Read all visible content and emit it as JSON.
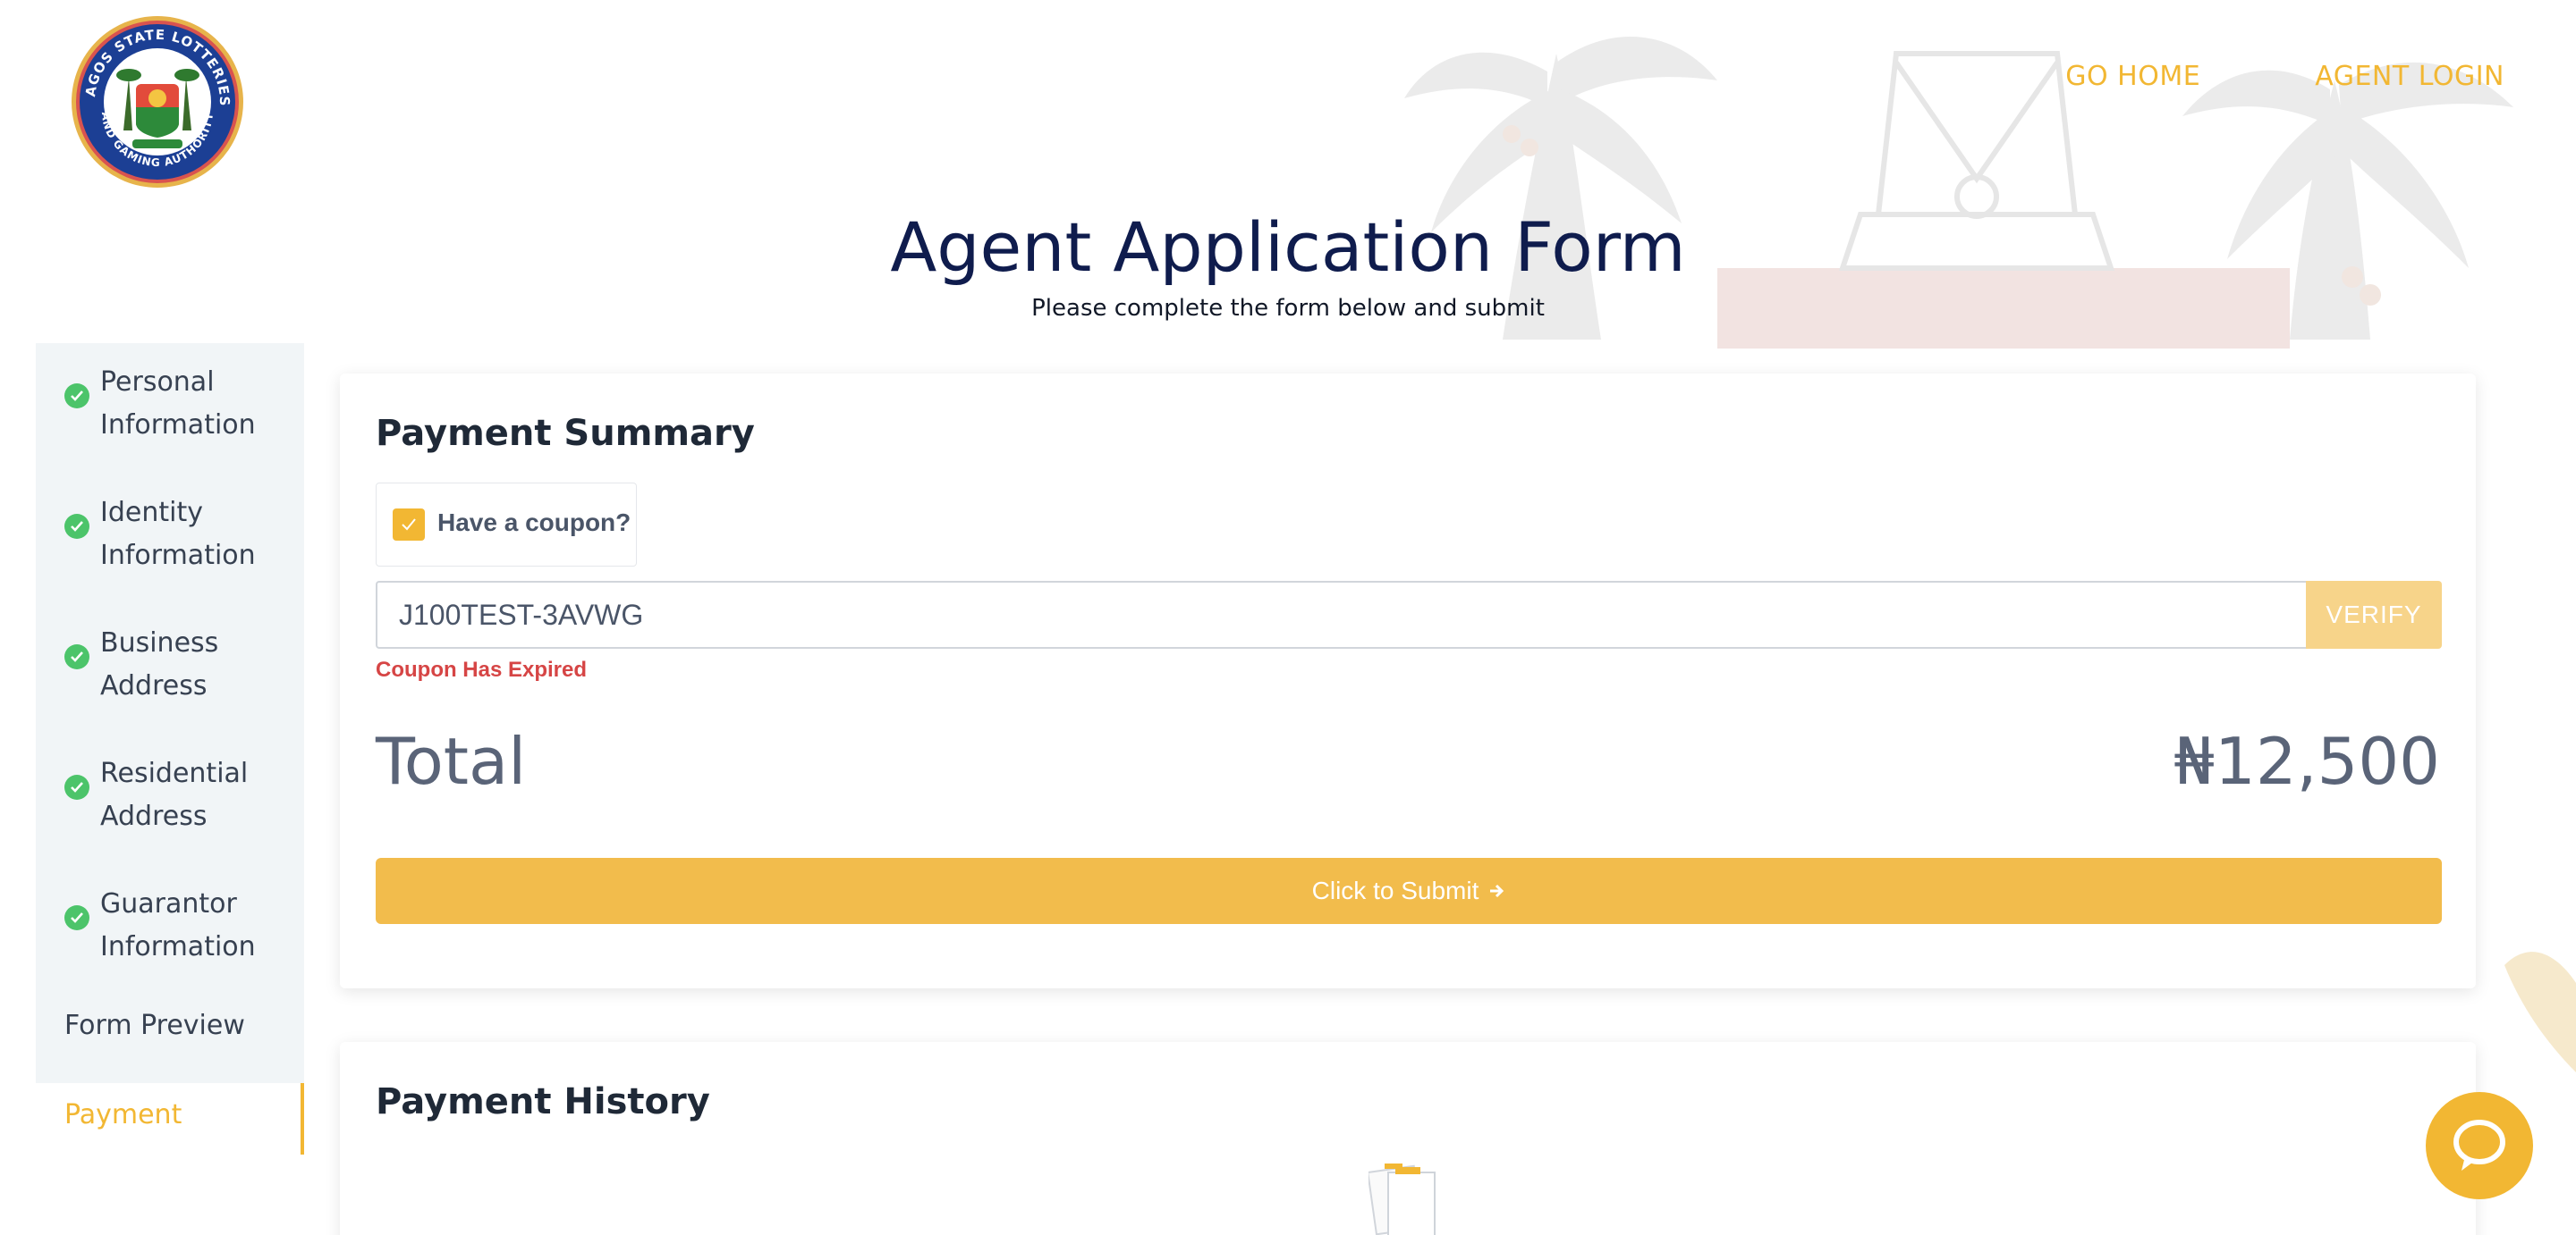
{
  "header": {
    "logo_text": "LAGOS STATE LOTTERIES AND GAMING AUTHORITY",
    "nav": {
      "go_home": "GO HOME",
      "agent_login": "AGENT LOGIN"
    }
  },
  "page": {
    "title": "Agent Application Form",
    "subtitle": "Please complete the form below and submit"
  },
  "sidebar": {
    "steps": [
      {
        "line1": "Personal",
        "line2": "Information",
        "status": "complete"
      },
      {
        "line1": "Identity",
        "line2": "Information",
        "status": "complete"
      },
      {
        "line1": "Business",
        "line2": "Address",
        "status": "complete"
      },
      {
        "line1": "Residential",
        "line2": "Address",
        "status": "complete"
      },
      {
        "line1": "Guarantor",
        "line2": "Information",
        "status": "complete"
      }
    ],
    "form_preview": "Form Preview",
    "payment": "Payment"
  },
  "payment_summary": {
    "title": "Payment Summary",
    "coupon_checkbox_label": "Have a coupon?",
    "coupon_checked": true,
    "coupon_value": "J100TEST-3AVWG",
    "verify_label": "VERIFY",
    "coupon_error": "Coupon Has Expired",
    "total_label": "Total",
    "total_value": "₦12,500",
    "submit_label": "Click to Submit"
  },
  "payment_history": {
    "title": "Payment History"
  },
  "colors": {
    "accent": "#f2b733",
    "title_navy": "#0f1c4d",
    "error": "#d64545",
    "success": "#4cc46a"
  },
  "icons": {
    "step_status": "check-circle-icon",
    "submit_arrow": "arrow-right-icon",
    "chat": "chat-bubble-icon",
    "empty_history": "empty-documents-icon"
  }
}
